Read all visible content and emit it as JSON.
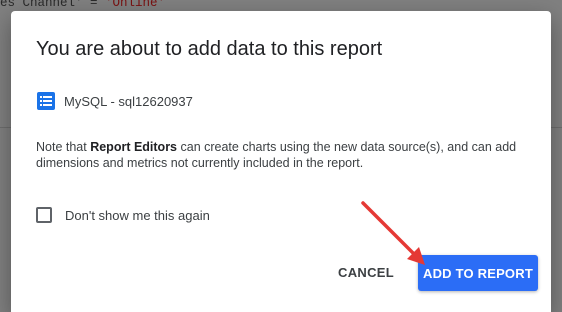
{
  "background": {
    "code_prefix": "es Channel' = ",
    "code_string": "'Online'"
  },
  "dialog": {
    "title": "You are about to add data to this report",
    "data_source": {
      "icon": "list-icon",
      "label": "MySQL - sql12620937"
    },
    "note": {
      "text_before": "Note that ",
      "bold": "Report Editors",
      "text_after": " can create charts using the new data source(s), and can add dimensions and metrics not currently included in the report."
    },
    "checkbox": {
      "label": "Don't show me this again",
      "checked": false
    },
    "buttons": {
      "cancel_label": "CANCEL",
      "add_label": "ADD TO REPORT"
    }
  },
  "colors": {
    "primary": "#2b6df6",
    "annotation_arrow": "#e53935"
  }
}
